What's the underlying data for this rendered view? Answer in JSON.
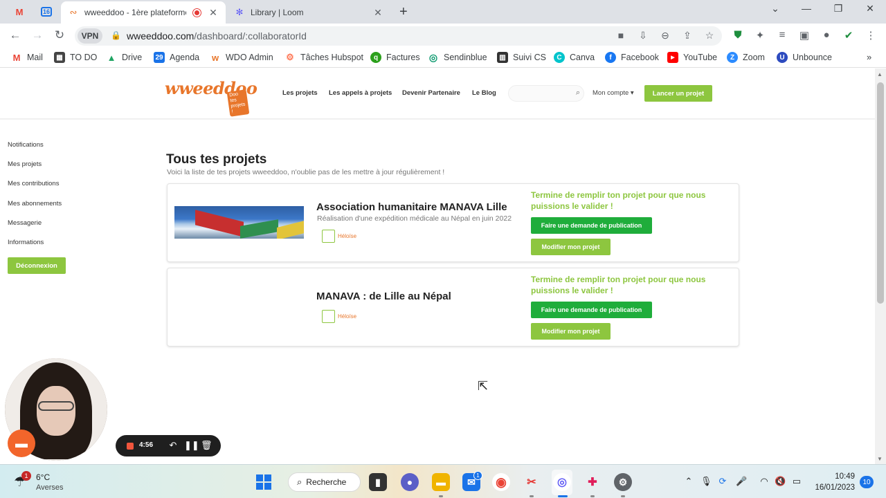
{
  "browser": {
    "pinned_tabs": [
      {
        "icon": "gmail-icon",
        "glyph": "M",
        "color": "#ea4335"
      },
      {
        "icon": "calendar-icon",
        "glyph": "16",
        "color": "#1a73e8"
      }
    ],
    "tabs": [
      {
        "title": "wweeddoo - 1ère plateforme",
        "active": true
      },
      {
        "title": "Library | Loom",
        "active": false
      }
    ],
    "new_tab_label": "+",
    "url_host": "wweeddoo.com",
    "url_path": "/dashboard/:collaboratorId",
    "vpn_label": "VPN"
  },
  "bookmarks": [
    {
      "label": "Mail",
      "color": "#ea4335",
      "glyph": "M"
    },
    {
      "label": "TO DO",
      "color": "#444444",
      "glyph": "▦"
    },
    {
      "label": "Drive",
      "color": "#1fa463",
      "glyph": "▲"
    },
    {
      "label": "Agenda",
      "color": "#1a73e8",
      "glyph": "29"
    },
    {
      "label": "WDO Admin",
      "color": "#e8762b",
      "glyph": "w"
    },
    {
      "label": "Tâches Hubspot",
      "color": "#ff7a59",
      "glyph": "⚙"
    },
    {
      "label": "Factures",
      "color": "#2ca01c",
      "glyph": "q"
    },
    {
      "label": "Sendinblue",
      "color": "#0b996e",
      "glyph": "◎"
    },
    {
      "label": "Suivi CS",
      "color": "#333333",
      "glyph": "▥"
    },
    {
      "label": "Canva",
      "color": "#00c4cc",
      "glyph": "C"
    },
    {
      "label": "Facebook",
      "color": "#1877f2",
      "glyph": "f"
    },
    {
      "label": "YouTube",
      "color": "#ff0000",
      "glyph": "▶"
    },
    {
      "label": "Zoom",
      "color": "#2d8cff",
      "glyph": "Z"
    },
    {
      "label": "Unbounce",
      "color": "#2d4bbf",
      "glyph": "U"
    }
  ],
  "site": {
    "logo_text": "wweeddoo",
    "logo_badge": "Doo tes projets !",
    "nav": [
      "Les projets",
      "Les appels à projets",
      "Devenir Partenaire",
      "Le Blog"
    ],
    "search_placeholder": "",
    "account_label": "Mon compte ▾",
    "launch_button": "Lancer un projet"
  },
  "sidebar": {
    "items": [
      "Notifications",
      "Mes projets",
      "Mes contributions",
      "Mes abonnements",
      "Messagerie",
      "Informations"
    ],
    "logout": "Déconnexion"
  },
  "main": {
    "title": "Tous tes projets",
    "subtitle": "Voici la liste de tes projets wweeddoo, n'oublie pas de les mettre à jour régulièrement !"
  },
  "projects": [
    {
      "title": "Association humanitaire MANAVA Lille",
      "subtitle": "Réalisation d'une expédition médicale au Népal en juin 2022",
      "owner": "Héloïse",
      "notice": "Termine de remplir ton projet pour que nous puissions le valider !",
      "publish_button": "Faire une demande de publication",
      "edit_button": "Modifier mon projet",
      "has_image": true
    },
    {
      "title": "MANAVA : de Lille au Népal",
      "subtitle": "",
      "owner": "Héloïse",
      "notice": "Termine de remplir ton projet pour que nous puissions le valider !",
      "publish_button": "Faire une demande de publication",
      "edit_button": "Modifier mon projet",
      "has_image": false
    }
  ],
  "loom": {
    "timer": "4:56"
  },
  "taskbar": {
    "weather_temp": "6°C",
    "weather_desc": "Averses",
    "weather_badge": "1",
    "search_label": "Recherche",
    "time": "10:49",
    "date": "16/01/2023",
    "notifications": "10",
    "mail_badge": "1"
  },
  "colors": {
    "brand_orange": "#e8762b",
    "brand_green": "#8dc63f",
    "publish_green": "#1fad3b"
  }
}
